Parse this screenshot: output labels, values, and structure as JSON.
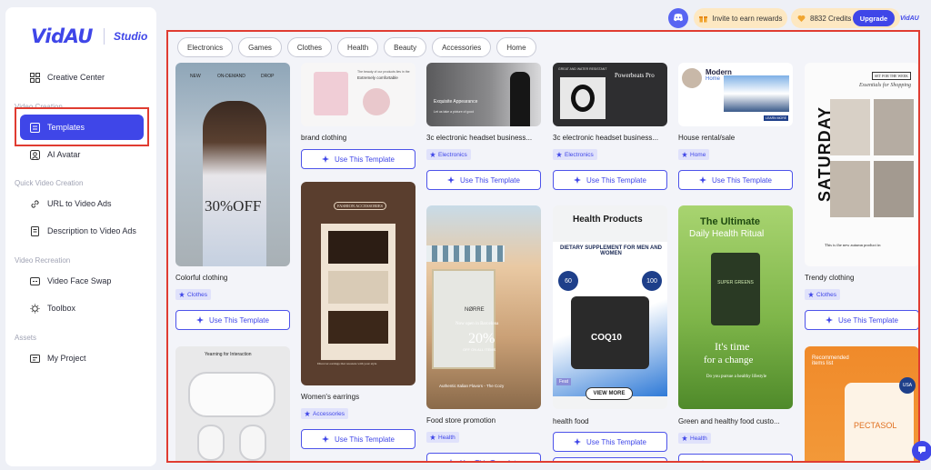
{
  "brand": {
    "name": "VidAU",
    "sub": "Studio"
  },
  "nav": {
    "creative_center": "Creative Center",
    "section_video_creation": "Video Creation",
    "templates": "Templates",
    "ai_avatar": "AI Avatar",
    "section_quick": "Quick Video Creation",
    "url_to_video": "URL to Video Ads",
    "desc_to_video": "Description to Video Ads",
    "section_recreation": "Video Recreation",
    "face_swap": "Video Face Swap",
    "toolbox": "Toolbox",
    "section_assets": "Assets",
    "my_project": "My Project"
  },
  "topbar": {
    "invite": "Invite to earn rewards",
    "credits": "8832 Credits",
    "upgrade": "Upgrade",
    "small_logo": "VidAU"
  },
  "filters": [
    "Electronics",
    "Games",
    "Clothes",
    "Health",
    "Beauty",
    "Accessories",
    "Home"
  ],
  "use_label": "Use This Template",
  "cards": {
    "c1": {
      "title": "Colorful clothing",
      "tag": "Clothes",
      "t1": "NEW",
      "t2": "ON-DEMAND",
      "t3": "DROP",
      "t4": "30%OFF",
      "t5": "Yearning for Interaction"
    },
    "c2": {
      "title": "brand clothing",
      "t1": "The beauty of our products lies in the",
      "t2": "Extremely comfortable",
      "title2": "Women's earrings",
      "tag2": "Accessories",
      "t3": "FASHION ACCESSORIES",
      "t4": "Discover earrings that resonate with your style"
    },
    "c3": {
      "title": "3c electronic headset business...",
      "tag": "Electronics",
      "t1": "Exquisite Appearance",
      "t2": "Let us take a picture of good",
      "title2": "Food store promotion",
      "tag2": "Health",
      "t3": "NØRRE",
      "t4": "Now open in Barcelona",
      "t5": "20%",
      "t6": "OFF ON ALL ITEMS",
      "t7": "Authentic Italian Flavors - The Cozy"
    },
    "c4": {
      "title": "3c electronic headset business...",
      "tag": "Electronics",
      "t1": "Powerbeats Pro",
      "t2": "GREAT AND WATER RESISTANT",
      "title2": "health food",
      "tag2": "Health",
      "t3": "Health Products",
      "t4": "DIETARY SUPPLEMENT FOR MEN AND WOMEN",
      "t5": "COQ10",
      "t6": "VIEW MORE",
      "t7": "60",
      "t8": "100",
      "t9": "Feat"
    },
    "c5": {
      "title": "House rental/sale",
      "tag": "Home",
      "t1": "Modern",
      "t2": "Home",
      "t3": "LEARN MORE",
      "title2": "Green and healthy food custo...",
      "tag2": "Health",
      "t4": "The Ultimate",
      "t5": "Daily Health Ritual",
      "t6": "SUPER GREENS",
      "t7": "It's time",
      "t8": "for a change",
      "t9": "Do you pursue a healthy lifestyle"
    },
    "c6": {
      "title": "Trendy clothing",
      "tag": "Clothes",
      "t1": "SATURDAY",
      "t2": "SET FOR THE WEEK",
      "t3": "Essentials for Shopping",
      "t4": "This is the new autumn product in",
      "t5": "Recommended items list",
      "t6": "PECTASOL",
      "t7": "USA"
    }
  }
}
